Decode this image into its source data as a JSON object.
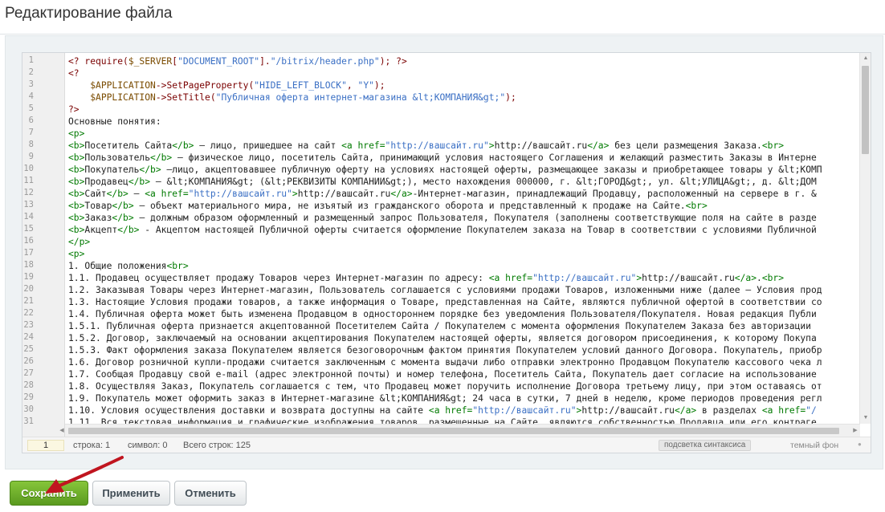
{
  "page": {
    "title": "Редактирование файла"
  },
  "editor": {
    "lines": [
      {
        "n": "1",
        "segs": [
          {
            "t": "<? ",
            "c": "php"
          },
          {
            "t": "require",
            "c": "php"
          },
          {
            "t": "(",
            "c": "php"
          },
          {
            "t": "$_SERVER",
            "c": "var"
          },
          {
            "t": "[",
            "c": "php"
          },
          {
            "t": "\"DOCUMENT_ROOT\"",
            "c": "str"
          },
          {
            "t": "].",
            "c": "php"
          },
          {
            "t": "\"/bitrix/header.php\"",
            "c": "str"
          },
          {
            "t": "); ?>",
            "c": "php"
          }
        ]
      },
      {
        "n": "2",
        "segs": [
          {
            "t": "<?",
            "c": "php"
          }
        ]
      },
      {
        "n": "3",
        "segs": [
          {
            "t": "    ",
            "c": ""
          },
          {
            "t": "$APPLICATION",
            "c": "var"
          },
          {
            "t": "->SetPageProperty(",
            "c": "php"
          },
          {
            "t": "\"HIDE_LEFT_BLOCK\"",
            "c": "str"
          },
          {
            "t": ", ",
            "c": "php"
          },
          {
            "t": "\"Y\"",
            "c": "str"
          },
          {
            "t": ");",
            "c": "php"
          }
        ]
      },
      {
        "n": "4",
        "segs": [
          {
            "t": "    ",
            "c": ""
          },
          {
            "t": "$APPLICATION",
            "c": "var"
          },
          {
            "t": "->SetTitle(",
            "c": "php"
          },
          {
            "t": "\"Публичная оферта интернет-магазина &lt;КОМПАНИЯ&gt;\"",
            "c": "str"
          },
          {
            "t": ");",
            "c": "php"
          }
        ]
      },
      {
        "n": "5",
        "segs": [
          {
            "t": "?>",
            "c": "php"
          }
        ]
      },
      {
        "n": "6",
        "segs": [
          {
            "t": "Основные понятия:",
            "c": ""
          }
        ]
      },
      {
        "n": "7",
        "segs": [
          {
            "t": "<p>",
            "c": "tag"
          }
        ]
      },
      {
        "n": "8",
        "segs": [
          {
            "t": "<b>",
            "c": "tag"
          },
          {
            "t": "Посетитель Сайта",
            "c": ""
          },
          {
            "t": "</b>",
            "c": "tag"
          },
          {
            "t": " — лицо, пришедшее на сайт ",
            "c": ""
          },
          {
            "t": "<a href=",
            "c": "tag"
          },
          {
            "t": "\"http://вашсайт.ru\"",
            "c": "str"
          },
          {
            "t": ">",
            "c": "tag"
          },
          {
            "t": "http://вашсайт.ru",
            "c": ""
          },
          {
            "t": "</a>",
            "c": "tag"
          },
          {
            "t": " без цели размещения Заказа.",
            "c": ""
          },
          {
            "t": "<br>",
            "c": "tag"
          }
        ]
      },
      {
        "n": "9",
        "segs": [
          {
            "t": "<b>",
            "c": "tag"
          },
          {
            "t": "Пользователь",
            "c": ""
          },
          {
            "t": "</b>",
            "c": "tag"
          },
          {
            "t": " — физическое лицо, посетитель Сайта, принимающий условия настоящего Соглашения и желающий разместить Заказы в Интерне",
            "c": ""
          }
        ]
      },
      {
        "n": "10",
        "segs": [
          {
            "t": "<b>",
            "c": "tag"
          },
          {
            "t": "Покупатель",
            "c": ""
          },
          {
            "t": "</b>",
            "c": "tag"
          },
          {
            "t": " —лицо, акцептовавшее публичную оферту на условиях настоящей оферты, размещающее заказы и приобретающее товары у &lt;КОМП",
            "c": ""
          }
        ]
      },
      {
        "n": "11",
        "segs": [
          {
            "t": "<b>",
            "c": "tag"
          },
          {
            "t": "Продавец",
            "c": ""
          },
          {
            "t": "</b>",
            "c": "tag"
          },
          {
            "t": " — &lt;КОМПАНИЯ&gt; (&lt;РЕКВИЗИТЫ КОМПАНИИ&gt;), место нахождения 000000, г. &lt;ГОРОД&gt;, ул. &lt;УЛИЦА&gt;, д. &lt;ДОМ",
            "c": ""
          }
        ]
      },
      {
        "n": "12",
        "segs": [
          {
            "t": "<b>",
            "c": "tag"
          },
          {
            "t": "Сайт",
            "c": ""
          },
          {
            "t": "</b>",
            "c": "tag"
          },
          {
            "t": " — ",
            "c": ""
          },
          {
            "t": "<a href=",
            "c": "tag"
          },
          {
            "t": "\"http://вашсайт.ru\"",
            "c": "str"
          },
          {
            "t": ">",
            "c": "tag"
          },
          {
            "t": "http://вашсайт.ru",
            "c": ""
          },
          {
            "t": "</a>",
            "c": "tag"
          },
          {
            "t": "-Интернет-магазин, принадлежащий Продавцу, расположенный на сервере в г. &",
            "c": ""
          }
        ]
      },
      {
        "n": "13",
        "segs": [
          {
            "t": "<b>",
            "c": "tag"
          },
          {
            "t": "Товар",
            "c": ""
          },
          {
            "t": "</b>",
            "c": "tag"
          },
          {
            "t": " — объект материального мира, не изъятый из гражданского оборота и представленный к продаже на Сайте.",
            "c": ""
          },
          {
            "t": "<br>",
            "c": "tag"
          }
        ]
      },
      {
        "n": "14",
        "segs": [
          {
            "t": "<b>",
            "c": "tag"
          },
          {
            "t": "Заказ",
            "c": ""
          },
          {
            "t": "</b>",
            "c": "tag"
          },
          {
            "t": " — должным образом оформленный и размещенный запрос Пользователя, Покупателя (заполнены соответствующие поля на сайте в разде",
            "c": ""
          }
        ]
      },
      {
        "n": "15",
        "segs": [
          {
            "t": "<b>",
            "c": "tag"
          },
          {
            "t": "Акцепт",
            "c": ""
          },
          {
            "t": "</b>",
            "c": "tag"
          },
          {
            "t": " - Акцептом настоящей Публичной оферты считается оформление Покупателем заказа на Товар в соответствии с условиями Публичной",
            "c": ""
          }
        ]
      },
      {
        "n": "16",
        "segs": [
          {
            "t": "</p>",
            "c": "tag"
          }
        ]
      },
      {
        "n": "17",
        "segs": [
          {
            "t": "<p>",
            "c": "tag"
          }
        ]
      },
      {
        "n": "18",
        "segs": [
          {
            "t": "1. Общие положения",
            "c": ""
          },
          {
            "t": "<br>",
            "c": "tag"
          }
        ]
      },
      {
        "n": "19",
        "segs": [
          {
            "t": "1.1. Продавец осуществляет продажу Товаров через Интернет-магазин по адресу: ",
            "c": ""
          },
          {
            "t": "<a href=",
            "c": "tag"
          },
          {
            "t": "\"http://вашсайт.ru\"",
            "c": "str"
          },
          {
            "t": ">",
            "c": "tag"
          },
          {
            "t": "http://вашсайт.ru",
            "c": ""
          },
          {
            "t": "</a>",
            "c": "tag"
          },
          {
            "t": ".",
            "c": ""
          },
          {
            "t": "<br>",
            "c": "tag"
          }
        ]
      },
      {
        "n": "20",
        "segs": [
          {
            "t": "1.2. Заказывая Товары через Интернет-магазин, Пользователь соглашается с условиями продажи Товаров, изложенными ниже (далее — Условия прод",
            "c": ""
          }
        ]
      },
      {
        "n": "21",
        "segs": [
          {
            "t": "1.3. Настоящие Условия продажи товаров, а также информация о Товаре, представленная на Сайте, являются публичной офертой в соответствии со",
            "c": ""
          }
        ]
      },
      {
        "n": "22",
        "segs": [
          {
            "t": "1.4. Публичная оферта может быть изменена Продавцом в одностороннем порядке без уведомления Пользователя/Покупателя. Новая редакция Публи",
            "c": ""
          }
        ]
      },
      {
        "n": "23",
        "segs": [
          {
            "t": "1.5.1. Публичная оферта признается акцептованной Посетителем Сайта / Покупателем с момента оформления Покупателем Заказа без авторизации",
            "c": ""
          }
        ]
      },
      {
        "n": "24",
        "segs": [
          {
            "t": "1.5.2. Договор, заключаемый на основании акцептирования Покупателем настоящей оферты, является договором присоединения, к которому Покупа",
            "c": ""
          }
        ]
      },
      {
        "n": "25",
        "segs": [
          {
            "t": "1.5.3. Факт оформления заказа Покупателем является безоговорочным фактом принятия Покупателем условий данного Договора. Покупатель, приобр",
            "c": ""
          }
        ]
      },
      {
        "n": "26",
        "segs": [
          {
            "t": "1.6. Договор розничной купли-продажи считается заключенным с момента выдачи либо отправки электронно Продавцом Покупателю кассового чека л",
            "c": ""
          }
        ]
      },
      {
        "n": "27",
        "segs": [
          {
            "t": "1.7. Сообщая Продавцу свой e-mail (адрес электронной почты) и номер телефона, Посетитель Сайта, Покупатель дает согласие на использование",
            "c": ""
          }
        ]
      },
      {
        "n": "28",
        "segs": [
          {
            "t": "1.8. Осуществляя Заказ, Покупатель соглашается с тем, что Продавец может поручить исполнение Договора третьему лицу, при этом оставаясь от",
            "c": ""
          }
        ]
      },
      {
        "n": "29",
        "segs": [
          {
            "t": "1.9. Покупатель может оформить заказ в Интернет-магазине &lt;КОМПАНИЯ&gt; 24 часа в сутки, 7 дней в неделю, кроме периодов проведения регл",
            "c": ""
          }
        ]
      },
      {
        "n": "30",
        "segs": [
          {
            "t": "1.10. Условия осуществления доставки и возврата доступны на сайте ",
            "c": ""
          },
          {
            "t": "<a href=",
            "c": "tag"
          },
          {
            "t": "\"http://вашсайт.ru\"",
            "c": "str"
          },
          {
            "t": ">",
            "c": "tag"
          },
          {
            "t": "http://вашсайт.ru",
            "c": ""
          },
          {
            "t": "</a>",
            "c": "tag"
          },
          {
            "t": " в разделах ",
            "c": ""
          },
          {
            "t": "<a href=",
            "c": "tag"
          },
          {
            "t": "\"/",
            "c": "str"
          }
        ]
      },
      {
        "n": "31",
        "segs": [
          {
            "t": "1.11. Вся текстовая информация и графические изображения товаров, размещенные на Сайте, являются собственностью Продавца или его контраге",
            "c": ""
          }
        ]
      }
    ]
  },
  "status": {
    "line_number": "1",
    "row": "строка: 1",
    "symbol": "символ: 0",
    "total": "Всего строк: 125",
    "syntax_button": "подсветка синтаксиса",
    "theme_button": "темный фон"
  },
  "buttons": {
    "save": "Сохранить",
    "apply": "Применить",
    "cancel": "Отменить"
  },
  "colors": {
    "save_green": "#6cb12b",
    "annotation_arrow": "#c0151f"
  }
}
